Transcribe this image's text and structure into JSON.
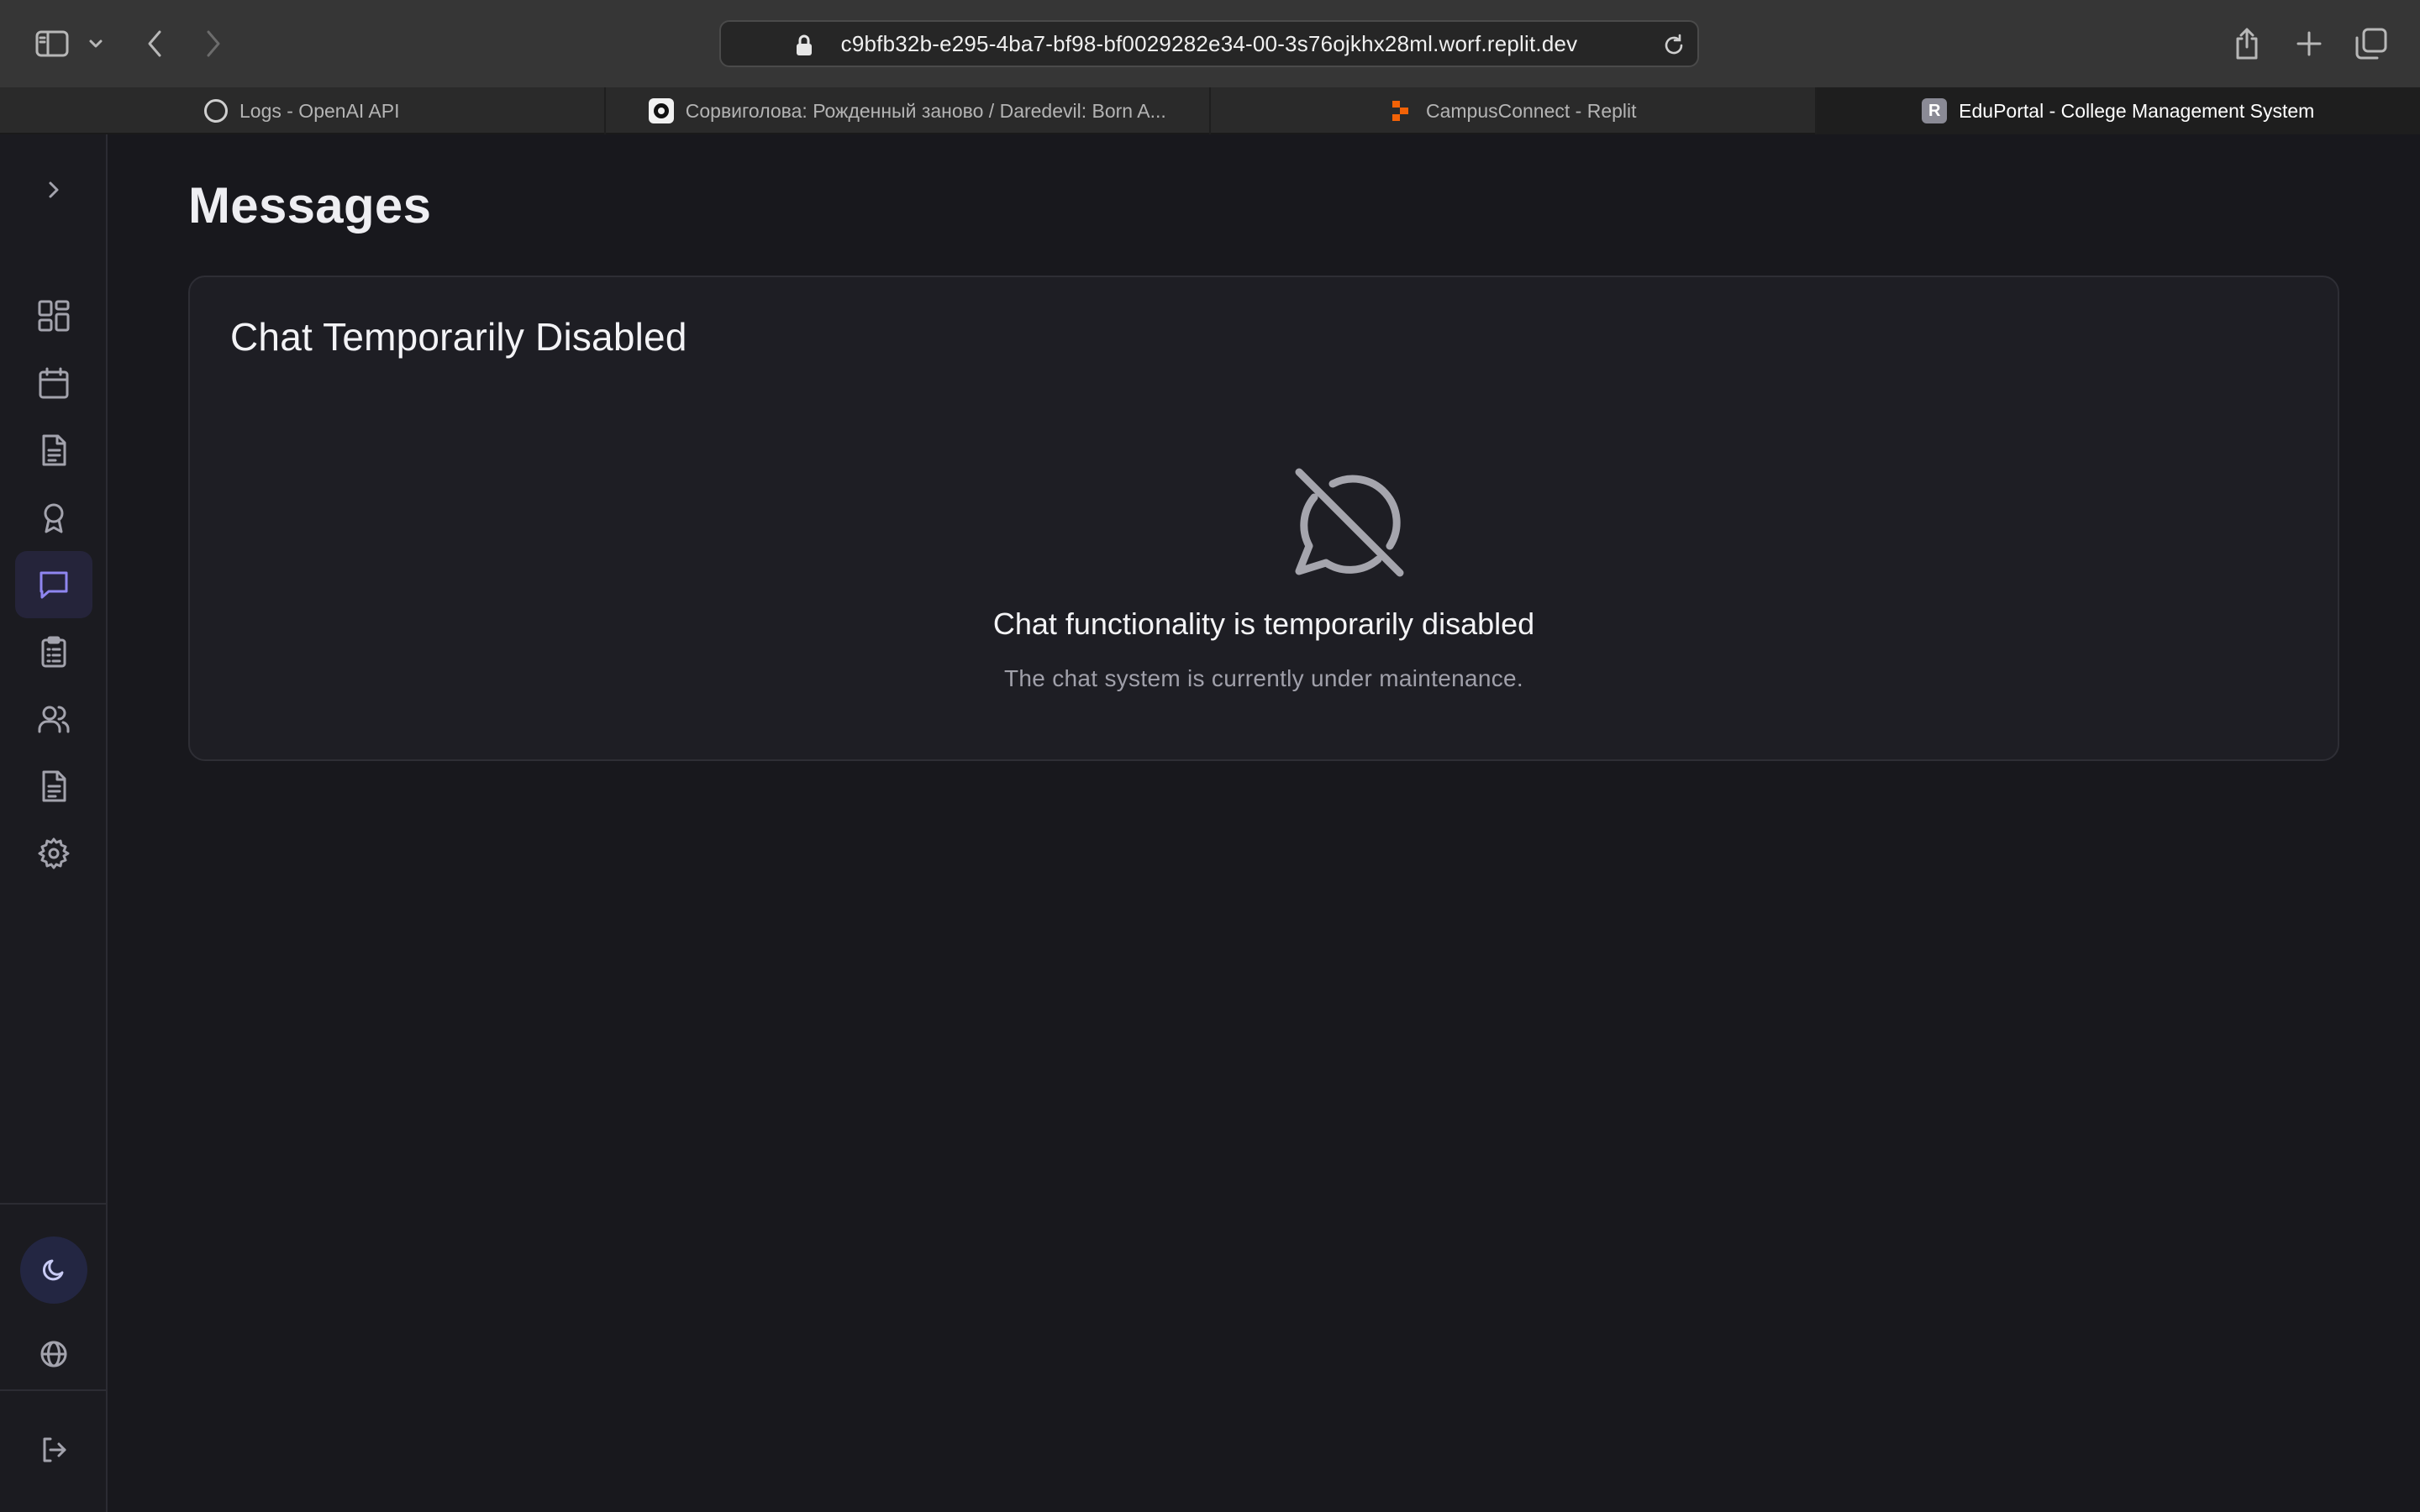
{
  "browser": {
    "url": "c9bfb32b-e295-4ba7-bf98-bf0029282e34-00-3s76ojkhx28ml.worf.replit.dev",
    "tabs": [
      {
        "label": "Logs - OpenAI API",
        "favicon": "openai-icon",
        "active": false
      },
      {
        "label": "Сорвиголова: Рожденный заново / Daredevil: Born A...",
        "favicon": "kinopoisk-icon",
        "active": false
      },
      {
        "label": "CampusConnect - Replit",
        "favicon": "replit-icon",
        "active": false
      },
      {
        "label": "EduPortal - College Management System",
        "favicon": "R",
        "active": true
      }
    ]
  },
  "sidebar": {
    "items": [
      {
        "icon": "dashboard-icon",
        "active": false
      },
      {
        "icon": "calendar-icon",
        "active": false
      },
      {
        "icon": "document-icon",
        "active": false
      },
      {
        "icon": "award-icon",
        "active": false
      },
      {
        "icon": "messages-icon",
        "active": true
      },
      {
        "icon": "clipboard-icon",
        "active": false
      },
      {
        "icon": "users-icon",
        "active": false
      },
      {
        "icon": "file-text-icon",
        "active": false
      },
      {
        "icon": "settings-icon",
        "active": false
      }
    ],
    "accent_color": "#8f86f0"
  },
  "main": {
    "title": "Messages",
    "card": {
      "title": "Chat Temporarily Disabled",
      "headline": "Chat functionality is temporarily disabled",
      "subtext": "The chat system is currently under maintenance."
    }
  }
}
